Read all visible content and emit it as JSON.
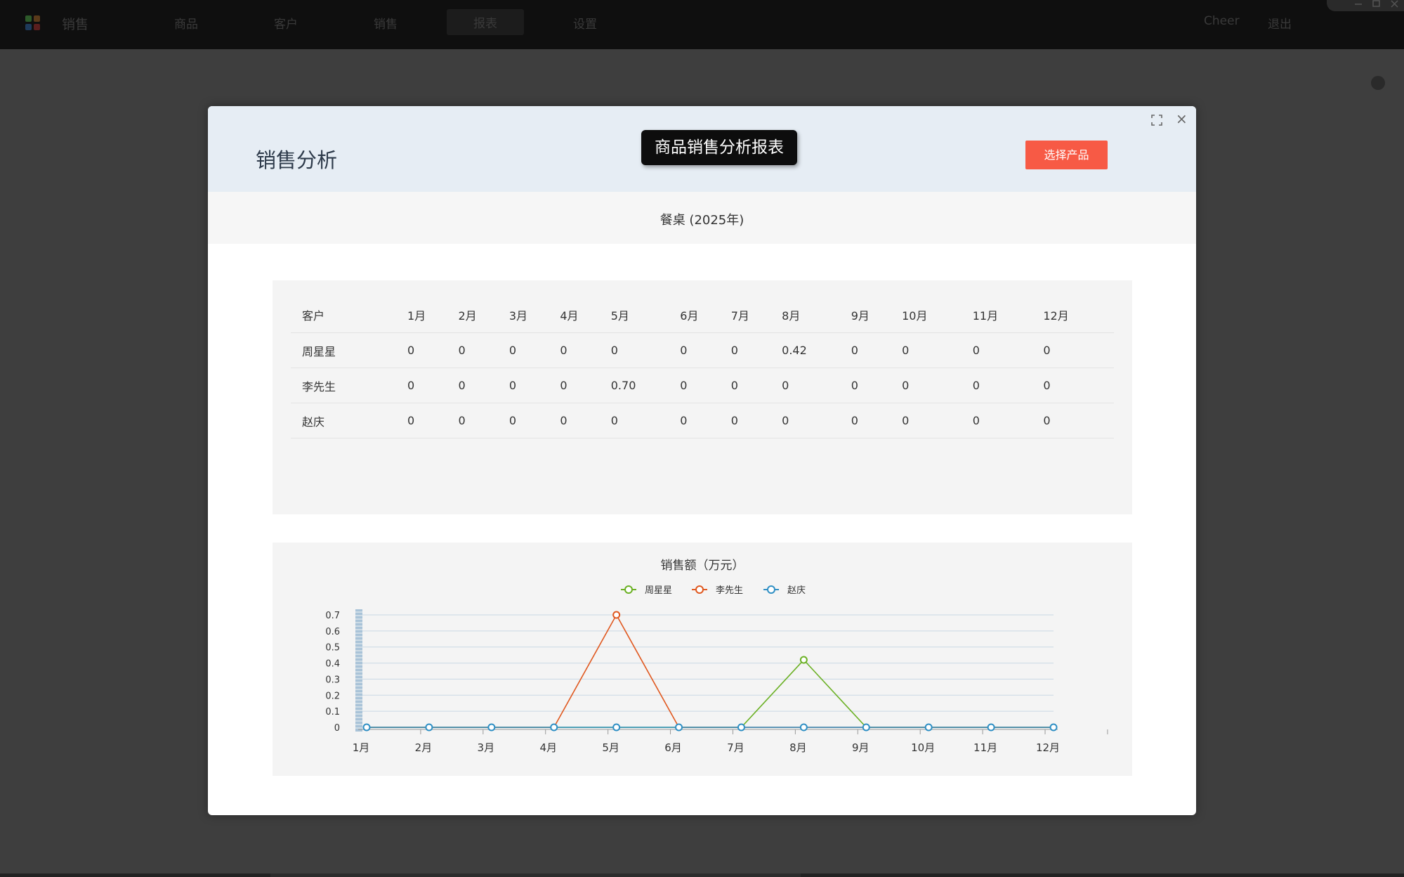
{
  "nav": {
    "brand": "销售",
    "items": [
      "商品",
      "客户",
      "销售",
      "报表",
      "设置"
    ],
    "active_index": 3,
    "user": "Cheer",
    "logout": "退出"
  },
  "modal": {
    "title": "销售分析",
    "report_badge": "商品销售分析报表",
    "select_button": "选择产品",
    "subtitle": "餐桌 (2025年)"
  },
  "table": {
    "headers": [
      "客户",
      "1月",
      "2月",
      "3月",
      "4月",
      "5月",
      "6月",
      "7月",
      "8月",
      "9月",
      "10月",
      "11月",
      "12月"
    ],
    "rows": [
      [
        "周星星",
        "0",
        "0",
        "0",
        "0",
        "0",
        "0",
        "0",
        "0.42",
        "0",
        "0",
        "0",
        "0"
      ],
      [
        "李先生",
        "0",
        "0",
        "0",
        "0",
        "0.70",
        "0",
        "0",
        "0",
        "0",
        "0",
        "0",
        "0"
      ],
      [
        "赵庆",
        "0",
        "0",
        "0",
        "0",
        "0",
        "0",
        "0",
        "0",
        "0",
        "0",
        "0",
        "0"
      ]
    ]
  },
  "chart_data": {
    "type": "line",
    "title": "销售额（万元）",
    "categories": [
      "1月",
      "2月",
      "3月",
      "4月",
      "5月",
      "6月",
      "7月",
      "8月",
      "9月",
      "10月",
      "11月",
      "12月"
    ],
    "series": [
      {
        "name": "周星星",
        "color": "#6ab023",
        "values": [
          0,
          0,
          0,
          0,
          0,
          0,
          0,
          0.42,
          0,
          0,
          0,
          0
        ]
      },
      {
        "name": "李先生",
        "color": "#e0581f",
        "values": [
          0,
          0,
          0,
          0,
          0.7,
          0,
          0,
          0,
          0,
          0,
          0,
          0
        ]
      },
      {
        "name": "赵庆",
        "color": "#2f8fc4",
        "values": [
          0,
          0,
          0,
          0,
          0,
          0,
          0,
          0,
          0,
          0,
          0,
          0
        ]
      }
    ],
    "y_ticks": [
      "0",
      "0.1",
      "0.2",
      "0.3",
      "0.4",
      "0.5",
      "0.6",
      "0.7"
    ],
    "ylim": [
      0,
      0.7
    ],
    "legend_position": "top-center",
    "grid": true
  },
  "colors": {
    "accent_button": "#f75a45",
    "header_bg": "#e6edf4"
  }
}
